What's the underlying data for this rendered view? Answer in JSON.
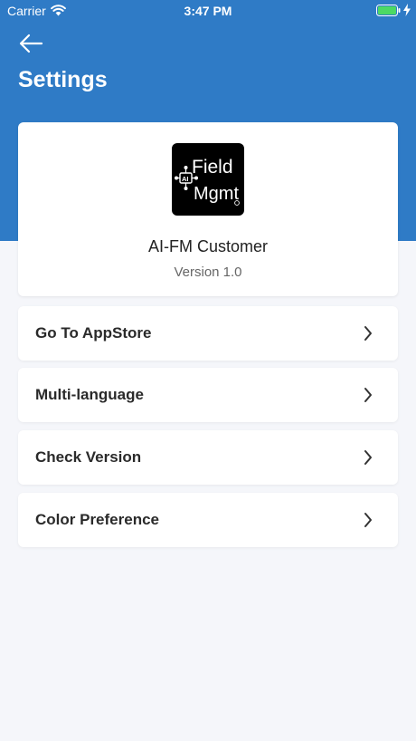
{
  "status_bar": {
    "carrier": "Carrier",
    "time": "3:47 PM",
    "wifi_icon": "wifi-icon",
    "battery_icon": "battery-icon",
    "battery_color": "#4cd964"
  },
  "header": {
    "title": "Settings",
    "back_icon": "back-arrow-icon",
    "background": "#2f7bc6"
  },
  "app_card": {
    "logo_line1": "Field",
    "logo_line2": "Mgmt",
    "logo_chip": "AI",
    "app_name": "AI-FM Customer",
    "version": "Version 1.0"
  },
  "menu": {
    "items": [
      {
        "label": "Go To AppStore"
      },
      {
        "label": "Multi-language"
      },
      {
        "label": "Check Version"
      },
      {
        "label": "Color Preference"
      }
    ],
    "chevron_icon": "chevron-right-icon"
  }
}
